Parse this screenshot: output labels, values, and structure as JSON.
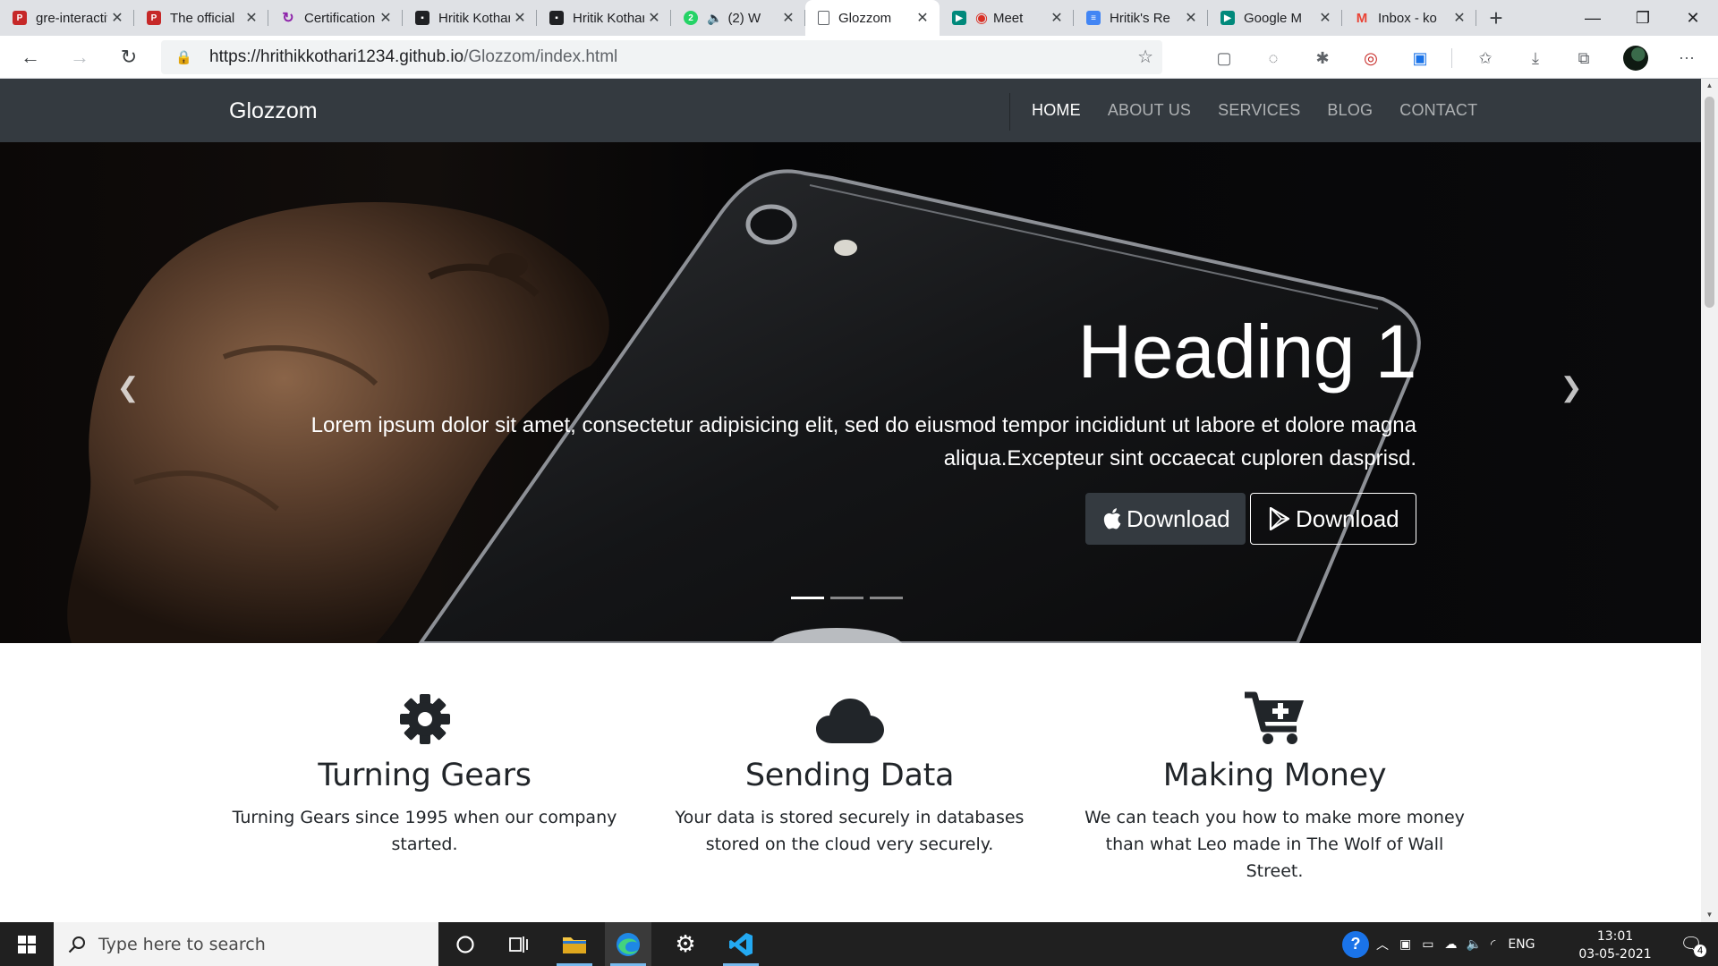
{
  "browser": {
    "tabs": [
      {
        "title": "gre-interactive",
        "favicon": "pdf-icon",
        "color": "#c62828"
      },
      {
        "title": "The official",
        "favicon": "pdf-icon",
        "color": "#c62828"
      },
      {
        "title": "Certification",
        "favicon": "certification-icon",
        "color": "#8e24aa"
      },
      {
        "title": "Hritik Kothari",
        "favicon": "profile-badge-icon",
        "color": "#202124"
      },
      {
        "title": "Hritik Kothari",
        "favicon": "profile-badge-icon",
        "color": "#202124"
      },
      {
        "title": "(2) W",
        "favicon": "whatsapp-icon",
        "color": "#25d366",
        "badge": "2"
      },
      {
        "title": "Glozzom",
        "favicon": "page-icon",
        "color": "#5f6368",
        "active": true
      },
      {
        "title": "Meet",
        "favicon": "meet-icon",
        "color": "#00897b"
      },
      {
        "title": "Hritik's Re",
        "favicon": "docs-icon",
        "color": "#4285f4"
      },
      {
        "title": "Google M",
        "favicon": "google-meet-icon",
        "color": "#00897b"
      },
      {
        "title": "Inbox - ko",
        "favicon": "gmail-icon",
        "color": "#ea4335"
      }
    ],
    "url_host": "https://hrithikkothari1234.github.io",
    "url_path": "/Glozzom/index.html"
  },
  "site": {
    "brand": "Glozzom",
    "nav": [
      {
        "label": "HOME",
        "active": true
      },
      {
        "label": "ABOUT US"
      },
      {
        "label": "SERVICES"
      },
      {
        "label": "BLOG"
      },
      {
        "label": "CONTACT"
      }
    ]
  },
  "hero": {
    "heading": "Heading 1",
    "lead": "Lorem ipsum dolor sit amet, consectetur adipisicing elit, sed do eiusmod tempor incididunt ut labore et dolore magna aliqua.Excepteur sint occaecat cuploren dasprisd.",
    "btn_apple": "Download",
    "btn_play": "Download",
    "indicators": 3,
    "active_indicator": 0
  },
  "features": [
    {
      "icon": "gear-icon",
      "title": "Turning Gears",
      "text": "Turning Gears since 1995 when our company started."
    },
    {
      "icon": "cloud-icon",
      "title": "Sending Data",
      "text": "Your data is stored securely in databases stored on the cloud very securely."
    },
    {
      "icon": "cart-plus-icon",
      "title": "Making Money",
      "text": "We can teach you how to make more money than what Leo made in The Wolf of Wall Street."
    }
  ],
  "taskbar": {
    "search_placeholder": "Type here to search",
    "language": "ENG",
    "time": "13:01",
    "date": "03-05-2021",
    "notification_count": "4"
  }
}
